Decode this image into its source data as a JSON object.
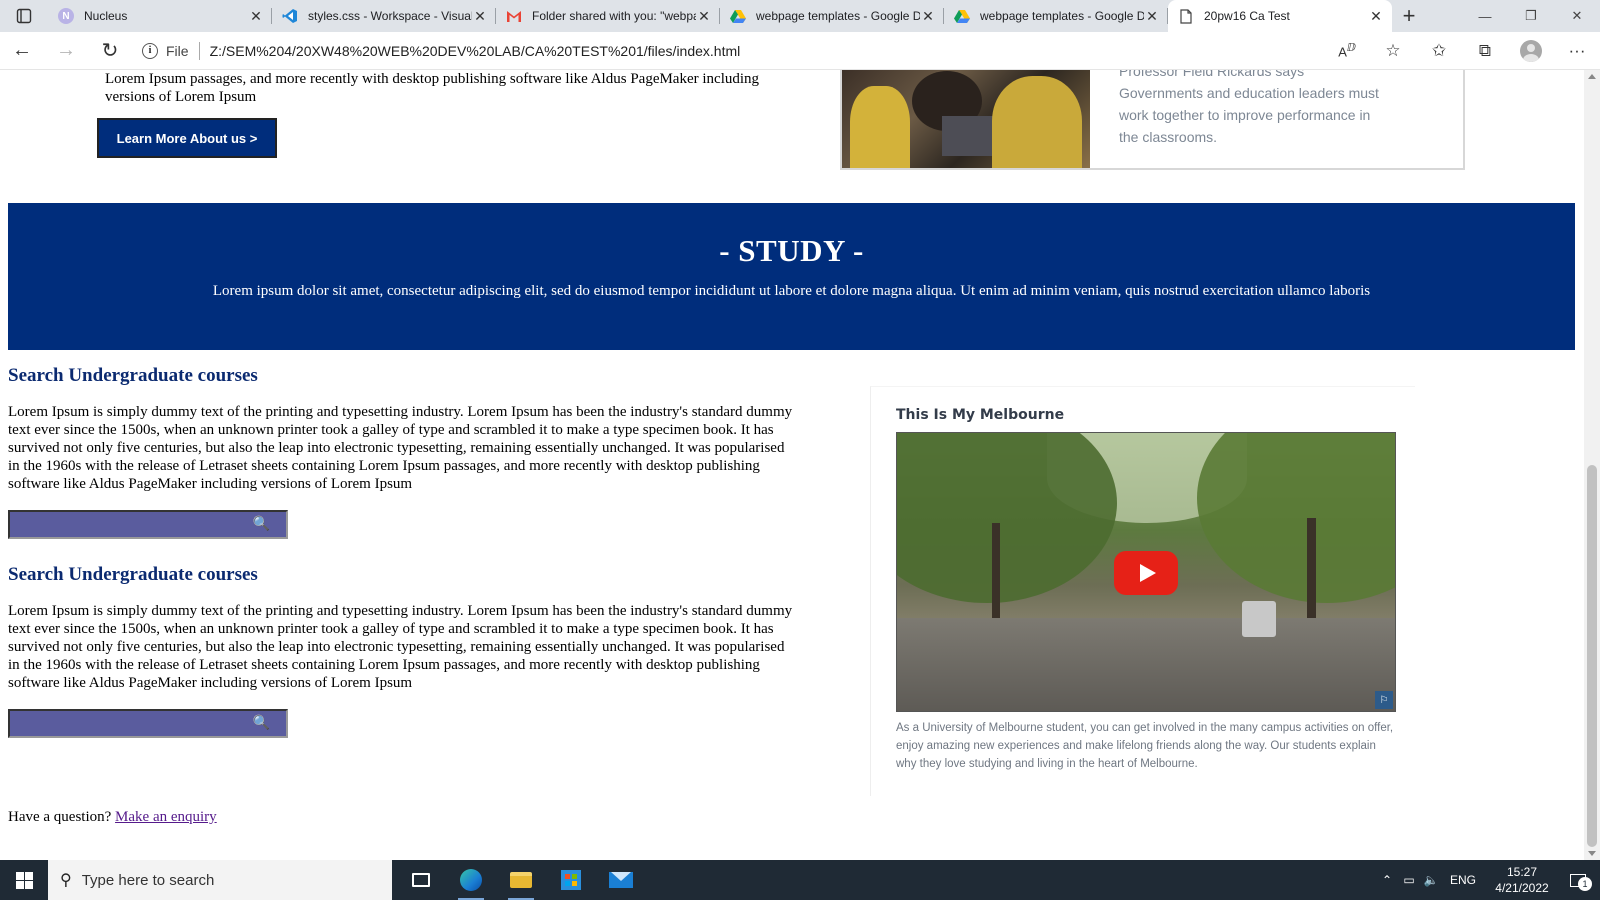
{
  "browser": {
    "tabs": [
      {
        "title": "Nucleus",
        "icon": "nucleus-icon",
        "active": false
      },
      {
        "title": "styles.css - Workspace - Visual",
        "icon": "vscode-icon",
        "active": false
      },
      {
        "title": "Folder shared with you: \"webpage",
        "icon": "gmail-icon",
        "active": false
      },
      {
        "title": "webpage templates - Google Drive",
        "icon": "drive-icon",
        "active": false
      },
      {
        "title": "webpage templates - Google Drive",
        "icon": "drive-icon",
        "active": false
      },
      {
        "title": "20pw16 Ca Test",
        "icon": "page-icon",
        "active": true
      }
    ],
    "new_tab": "+",
    "window_controls": {
      "minimize": "—",
      "restore": "❐",
      "close": "✕"
    },
    "address": {
      "scheme_label": "File",
      "url": "Z:/SEM%204/20XW48%20WEB%20DEV%20LAB/CA%20TEST%201/files/index.html"
    }
  },
  "page": {
    "intro": {
      "text": "Lorem Ipsum passages, and more recently with desktop publishing software like Aldus PageMaker including versions of Lorem Ipsum",
      "button_label": "Learn More About us >"
    },
    "news_card": {
      "text": "Professor Field Rickards says Governments and education leaders must work together to improve performance in the classrooms."
    },
    "study": {
      "heading": "- STUDY -",
      "text": "Lorem ipsum dolor sit amet, consectetur adipiscing elit, sed do eiusmod tempor incididunt ut labore et dolore magna aliqua. Ut enim ad minim veniam, quis nostrud exercitation ullamco laboris"
    },
    "sections": [
      {
        "title": "Search Undergraduate courses",
        "body": "Lorem Ipsum is simply dummy text of the printing and typesetting industry. Lorem Ipsum has been the industry's standard dummy text ever since the 1500s, when an unknown printer took a galley of type and scrambled it to make a type specimen book. It has survived not only five centuries, but also the leap into electronic typesetting, remaining essentially unchanged. It was popularised in the 1960s with the release of Letraset sheets containing Lorem Ipsum passages, and more recently with desktop publishing software like Aldus PageMaker including versions of Lorem Ipsum",
        "search_placeholder": ""
      },
      {
        "title": "Search Undergraduate courses",
        "body": "Lorem Ipsum is simply dummy text of the printing and typesetting industry. Lorem Ipsum has been the industry's standard dummy text ever since the 1500s, when an unknown printer took a galley of type and scrambled it to make a type specimen book. It has survived not only five centuries, but also the leap into electronic typesetting, remaining essentially unchanged. It was popularised in the 1960s with the release of Letraset sheets containing Lorem Ipsum passages, and more recently with desktop publishing software like Aldus PageMaker including versions of Lorem Ipsum",
        "search_placeholder": ""
      }
    ],
    "video": {
      "title": "This Is My Melbourne",
      "caption": "As a University of Melbourne student, you can get involved in the many campus activities on offer, enjoy amazing new experiences and make lifelong friends along the way. Our students explain why they love studying and living in the heart of Melbourne."
    },
    "enquiry": {
      "prefix": "Have a question?",
      "link": "Make an enquiry"
    }
  },
  "taskbar": {
    "search_placeholder": "Type here to search",
    "apps": [
      "task-view-icon",
      "edge-icon",
      "file-explorer-icon",
      "store-icon",
      "mail-icon"
    ],
    "language": "ENG",
    "time": "15:27",
    "date": "4/21/2022",
    "notification_count": "1"
  },
  "colors": {
    "brand_navy": "#002d7c",
    "search_field": "#5a5c9e",
    "visited_link": "#551a8b"
  }
}
